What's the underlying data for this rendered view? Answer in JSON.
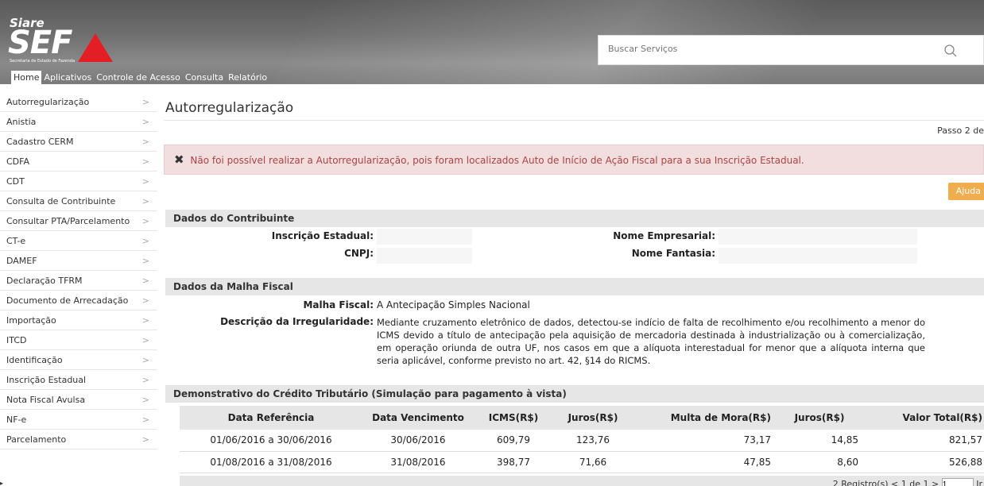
{
  "header": {
    "logo_top": "Siare",
    "logo_main": "SEF",
    "logo_sub": "Secretaria de Estado de Fazenda",
    "search_placeholder": "Buscar Serviços"
  },
  "nav": [
    "Home",
    "Aplicativos",
    "Controle de Acesso",
    "Consulta",
    "Relatório"
  ],
  "sidebar": [
    "Autorregularização",
    "Anistia",
    "Cadastro CERM",
    "CDFA",
    "CDT",
    "Consulta de Contribuinte",
    "Consultar PTA/Parcelamento",
    "CT-e",
    "DAMEF",
    "Declaração TFRM",
    "Documento de Arrecadação",
    "Importação",
    "ITCD",
    "Identificação",
    "Inscrição Estadual",
    "Nota Fiscal Avulsa",
    "NF-e",
    "Parcelamento"
  ],
  "main": {
    "title": "Autorregularização",
    "step": "Passo 2 de",
    "alert": "Não foi possível realizar a Autorregularização, pois foram localizados Auto de Início de Ação Fiscal para a sua Inscrição Estadual.",
    "help": "Ajuda"
  },
  "contribuinte": {
    "heading": "Dados do Contribuinte",
    "ie_label": "Inscrição Estadual:",
    "nome_emp_label": "Nome Empresarial:",
    "cnpj_label": "CNPJ:",
    "nome_fant_label": "Nome Fantasia:"
  },
  "malha": {
    "heading": "Dados da Malha Fiscal",
    "malha_label": "Malha Fiscal:",
    "malha_value": "A Antecipação Simples Nacional",
    "desc_label": "Descrição da Irregularidade:",
    "desc_value": "Mediante cruzamento eletrônico de dados, detectou-se indício de falta de recolhimento e/ou recolhimento a menor do ICMS devido a título de antecipação pela aquisição de mercadoria destinada à industrialização ou à comercialização, em operação oriunda de outra UF, nos casos em que a alíquota interestadual for menor que a alíquota interna que seria aplicável, conforme previsto no art. 42, §14 do RICMS."
  },
  "demonstrativo": {
    "heading": "Demonstrativo do Crédito Tributário (Simulação para pagamento à vista)",
    "columns": [
      "Data Referência",
      "Data Vencimento",
      "ICMS(R$)",
      "Juros(R$)",
      "Multa de Mora(R$)",
      "Juros(R$)",
      "Valor Total(R$)"
    ],
    "rows": [
      [
        "01/06/2016 a 30/06/2016",
        "30/06/2016",
        "609,79",
        "123,76",
        "73,17",
        "14,85",
        "821,57"
      ],
      [
        "01/08/2016 a 31/08/2016",
        "31/08/2016",
        "398,77",
        "71,66",
        "47,85",
        "8,60",
        "526,88"
      ]
    ],
    "pager_text": "2 Registro(s) < 1 de 1 >",
    "pager_value": "1",
    "pager_go": "Ir"
  }
}
